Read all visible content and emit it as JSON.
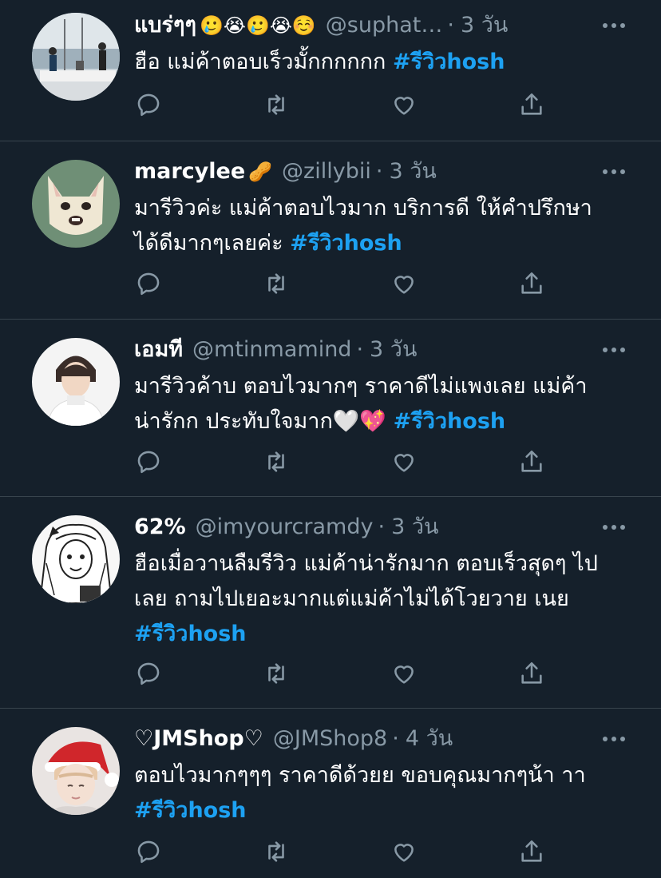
{
  "colors": {
    "background": "#15202b",
    "divider": "#38444d",
    "text": "#ffffff",
    "secondary_text": "#8899a6",
    "hashtag": "#1da1f2"
  },
  "tweets": [
    {
      "display_name": "แบร่ๆๆ",
      "emoji": "🥲😭🥲😭☺️",
      "handle": "@suphat…",
      "separator": "·",
      "time": "3 วัน",
      "text": "ฮือ แม่ค้าตอบเร็วมั้กกกกกก ",
      "hashtag": "#รีวิวhosh"
    },
    {
      "display_name": "marcylee",
      "emoji": "🥜",
      "handle": "@zillybii",
      "separator": "·",
      "time": "3 วัน",
      "text": "มารีวิวค่ะ แม่ค้าตอบไวมาก บริการดี ให้คำปรึกษาได้ดีมากๆเลยค่ะ ",
      "hashtag": "#รีวิวhosh"
    },
    {
      "display_name": "เอมที",
      "emoji": "",
      "handle": "@mtinmamind",
      "separator": "·",
      "time": "3 วัน",
      "text": "มารีวิวค้าบ ตอบไวมากๆ ราคาดีไม่แพงเลย แม่ค้าน่ารักก ประทับใจมาก🤍💖 ",
      "hashtag": "#รีวิวhosh"
    },
    {
      "display_name": "62%",
      "emoji": "",
      "handle": "@imyourcramdy",
      "separator": "·",
      "time": "3 วัน",
      "text": "ฮือเมื่อวานลืมรีวิว แม่ค้าน่ารักมาก ตอบเร็วสุดๆ ไปเลย ถามไปเยอะมากแต่แม่ค้าไม่ได้โวยวาย เนย ",
      "hashtag": "#รีวิวhosh"
    },
    {
      "display_name": "♡JMShop♡",
      "emoji": "",
      "handle": "@JMShop8",
      "separator": "·",
      "time": "4 วัน",
      "text": "ตอบไวมากๆๆๆ ราคาดีด้วยย ขอบคุณมากๆน้า าา  ",
      "hashtag": "#รีวิวhosh"
    }
  ]
}
